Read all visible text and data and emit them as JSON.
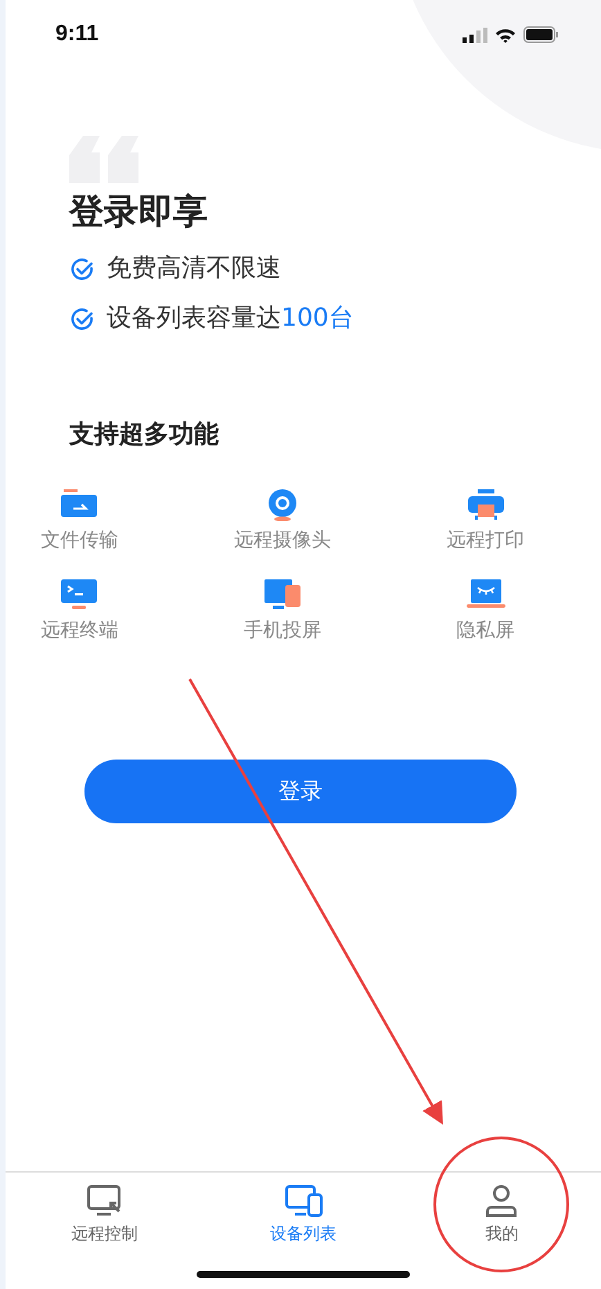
{
  "status_bar": {
    "time": "9:11"
  },
  "hero": {
    "title": "登录即享",
    "benefits": [
      {
        "text": "免费高清不限速"
      },
      {
        "text": "设备列表容量达",
        "highlight": "100台"
      }
    ]
  },
  "features": {
    "title": "支持超多功能",
    "items": [
      {
        "kind": "file",
        "label": "文件传输"
      },
      {
        "kind": "camera",
        "label": "远程摄像头"
      },
      {
        "kind": "printer",
        "label": "远程打印"
      },
      {
        "kind": "terminal",
        "label": "远程终端"
      },
      {
        "kind": "cast",
        "label": "手机投屏"
      },
      {
        "kind": "privacy",
        "label": "隐私屏"
      }
    ]
  },
  "login_button": {
    "label": "登录"
  },
  "tab_bar": [
    {
      "kind": "remote",
      "label": "远程控制",
      "selected": false
    },
    {
      "kind": "devices",
      "label": "设备列表",
      "selected": true
    },
    {
      "kind": "me",
      "label": "我的",
      "selected": false
    }
  ]
}
